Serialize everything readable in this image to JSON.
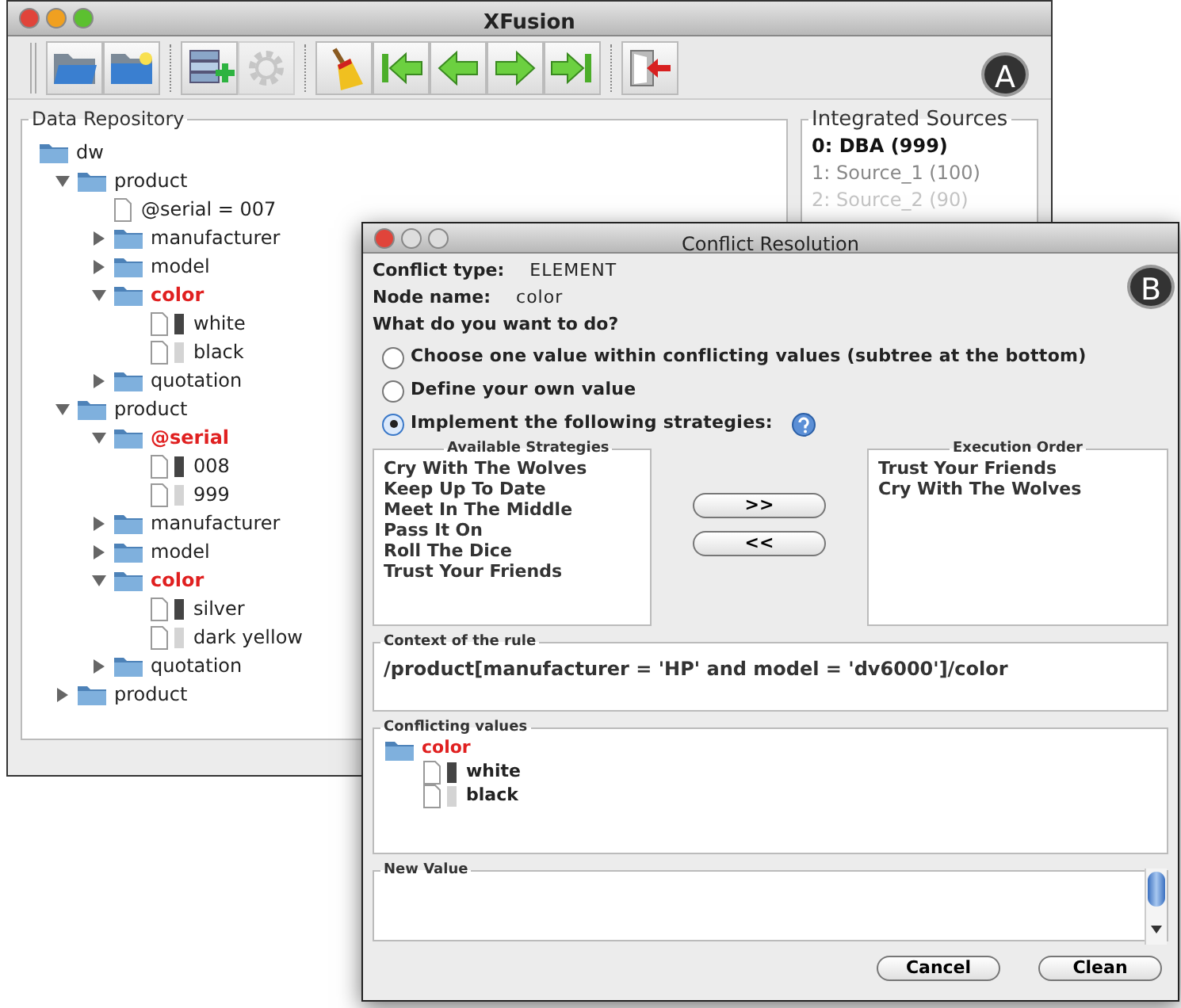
{
  "main_window": {
    "title": "XFusion",
    "label": "A",
    "toolbar": [
      [
        {
          "kind": "open-folder",
          "disabled": false
        },
        {
          "kind": "new-folder",
          "disabled": false
        }
      ],
      [
        {
          "kind": "database-add",
          "disabled": false
        },
        {
          "kind": "gear",
          "disabled": true
        }
      ],
      [
        {
          "kind": "broom",
          "disabled": false
        },
        {
          "kind": "first",
          "disabled": false
        },
        {
          "kind": "previous",
          "disabled": false
        },
        {
          "kind": "next",
          "disabled": false
        },
        {
          "kind": "last",
          "disabled": false
        }
      ],
      [
        {
          "kind": "exit",
          "disabled": false
        }
      ]
    ],
    "repository": {
      "title": "Data Repository",
      "tree": [
        {
          "label": "dw",
          "kind": "folder",
          "conflict": false,
          "children": [
            {
              "label": "product",
              "kind": "folder",
              "expanded": true,
              "conflict": false,
              "children": [
                {
                  "label": "@serial = 007",
                  "kind": "leaf"
                },
                {
                  "label": "manufacturer",
                  "kind": "folder",
                  "expanded": false,
                  "conflict": false
                },
                {
                  "label": "model",
                  "kind": "folder",
                  "expanded": false,
                  "conflict": false
                },
                {
                  "label": "color",
                  "kind": "folder",
                  "expanded": true,
                  "conflict": true,
                  "children": [
                    {
                      "label": "white",
                      "kind": "leaf",
                      "color": "#444444"
                    },
                    {
                      "label": "black",
                      "kind": "leaf",
                      "color": "#d4d4d4"
                    }
                  ]
                },
                {
                  "label": "quotation",
                  "kind": "folder",
                  "expanded": false,
                  "conflict": false
                }
              ]
            },
            {
              "label": "product",
              "kind": "folder",
              "expanded": true,
              "conflict": false,
              "children": [
                {
                  "label": "@serial",
                  "kind": "folder",
                  "expanded": true,
                  "conflict": true,
                  "children": [
                    {
                      "label": "008",
                      "kind": "leaf",
                      "color": "#444444"
                    },
                    {
                      "label": "999",
                      "kind": "leaf",
                      "color": "#d4d4d4"
                    }
                  ]
                },
                {
                  "label": "manufacturer",
                  "kind": "folder",
                  "expanded": false,
                  "conflict": false
                },
                {
                  "label": "model",
                  "kind": "folder",
                  "expanded": false,
                  "conflict": false
                },
                {
                  "label": "color",
                  "kind": "folder",
                  "expanded": true,
                  "conflict": true,
                  "children": [
                    {
                      "label": "silver",
                      "kind": "leaf",
                      "color": "#444444"
                    },
                    {
                      "label": "dark yellow",
                      "kind": "leaf",
                      "color": "#d4d4d4"
                    }
                  ]
                },
                {
                  "label": "quotation",
                  "kind": "folder",
                  "expanded": false,
                  "conflict": false
                }
              ]
            },
            {
              "label": "product",
              "kind": "folder",
              "expanded": false,
              "conflict": false
            }
          ]
        }
      ]
    },
    "sources": {
      "title": "Integrated Sources",
      "items": [
        {
          "text": "0: DBA (999)",
          "selected": true,
          "disabled": false
        },
        {
          "text": "1: Source_1 (100)",
          "selected": false,
          "disabled": false
        },
        {
          "text": "2: Source_2 (90)",
          "selected": false,
          "disabled": true
        }
      ]
    }
  },
  "dialog": {
    "title": "Conflict Resolution",
    "label": "B",
    "fields": [
      {
        "label": "Conflict type:",
        "value": "ELEMENT"
      },
      {
        "label": "Node name:",
        "value": "color"
      }
    ],
    "question": "What do you want to do?",
    "options": [
      {
        "text": "Choose one value within conflicting values (subtree at the bottom)",
        "selected": false,
        "help": false
      },
      {
        "text": "Define your own value",
        "selected": false,
        "help": false
      },
      {
        "text": "Implement the following strategies:",
        "selected": true,
        "help": true
      }
    ],
    "available": {
      "title": "Available Strategies",
      "items": [
        "Cry With The Wolves",
        "Keep Up To Date",
        "Meet In The Middle",
        "Pass It On",
        "Roll The Dice",
        "Trust Your Friends"
      ]
    },
    "move_buttons": [
      ">>",
      "<<"
    ],
    "execution": {
      "title": "Execution Order",
      "items": [
        "Trust Your Friends",
        "Cry With The Wolves"
      ]
    },
    "context": {
      "title": "Context of the rule",
      "text": "/product[manufacturer = 'HP' and model = 'dv6000']/color"
    },
    "conflicting": {
      "title": "Conflicting values",
      "tree": [
        {
          "label": "color",
          "kind": "folder",
          "conflict": true,
          "children": [
            {
              "label": "white",
              "kind": "leaf",
              "color": "#444444"
            },
            {
              "label": "black",
              "kind": "leaf",
              "color": "#d4d4d4"
            }
          ]
        }
      ]
    },
    "new_value": {
      "title": "New Value"
    },
    "buttons": [
      "Cancel",
      "Clean"
    ]
  }
}
